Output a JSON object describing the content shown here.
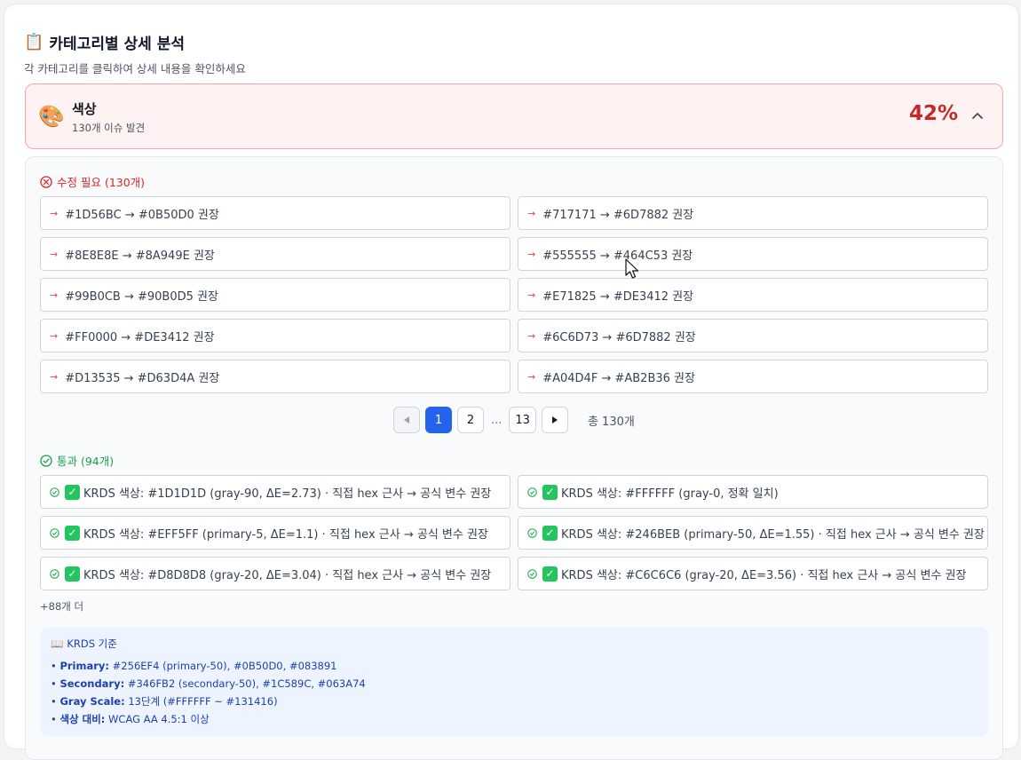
{
  "page": {
    "title": "카테고리별 상세 분석",
    "subtitle": "각 카테고리를 클릭하여 상세 내용을 확인하세요"
  },
  "category": {
    "icon": "palette-icon",
    "name": "색상",
    "issue_count": "130개 이슈 발견",
    "score": "42%",
    "expanded": true
  },
  "fail_section": {
    "title": "수정 필요 (130개)",
    "items": [
      "#1D56BC → #0B50D0 권장",
      "#717171 → #6D7882 권장",
      "#8E8E8E → #8A949E 권장",
      "#555555 → #464C53 권장",
      "#99B0CB → #90B0D5 권장",
      "#E71825 → #DE3412 권장",
      "#FF0000 → #DE3412 권장",
      "#6C6D73 → #6D7882 권장",
      "#D13535 → #D63D4A 권장",
      "#A04D4F → #AB2B36 권장"
    ]
  },
  "pagination": {
    "pages": [
      "1",
      "2",
      "13"
    ],
    "ellipsis": "...",
    "current": "1",
    "total": "총 130개"
  },
  "pass_section": {
    "title": "통과 (94개)",
    "items": [
      "KRDS 색상: #1D1D1D (gray-90, ΔE=2.73) · 직접 hex 근사 → 공식 변수 권장",
      "KRDS 색상: #FFFFFF (gray-0, 정확 일치)",
      "KRDS 색상: #EFF5FF (primary-5, ΔE=1.1) · 직접 hex 근사 → 공식 변수 권장",
      "KRDS 색상: #246BEB (primary-50, ΔE=1.55) · 직접 hex 근사 → 공식 변수 권장",
      "KRDS 색상: #D8D8D8 (gray-20, ΔE=3.04) · 직접 hex 근사 → 공식 변수 권장",
      "KRDS 색상: #C6C6C6 (gray-20, ΔE=3.56) · 직접 hex 근사 → 공식 변수 권장"
    ],
    "more": "+88개 더"
  },
  "reference": {
    "title": "KRDS 기준",
    "lines": [
      {
        "label": "Primary:",
        "value": "#256EF4 (primary-50), #0B50D0, #083891"
      },
      {
        "label": "Secondary:",
        "value": "#346FB2 (secondary-50), #1C589C, #063A74"
      },
      {
        "label": "Gray Scale:",
        "value": "13단계 (#FFFFFF ~ #131416)"
      },
      {
        "label": "색상 대비:",
        "value": "WCAG AA 4.5:1 이상"
      }
    ]
  },
  "colors": {
    "fail": "#dc2626",
    "pass": "#16a34a",
    "score": "#c62828",
    "accent": "#2563eb",
    "header_bg": "#fef2f2",
    "reference_bg": "#eef4ff"
  }
}
